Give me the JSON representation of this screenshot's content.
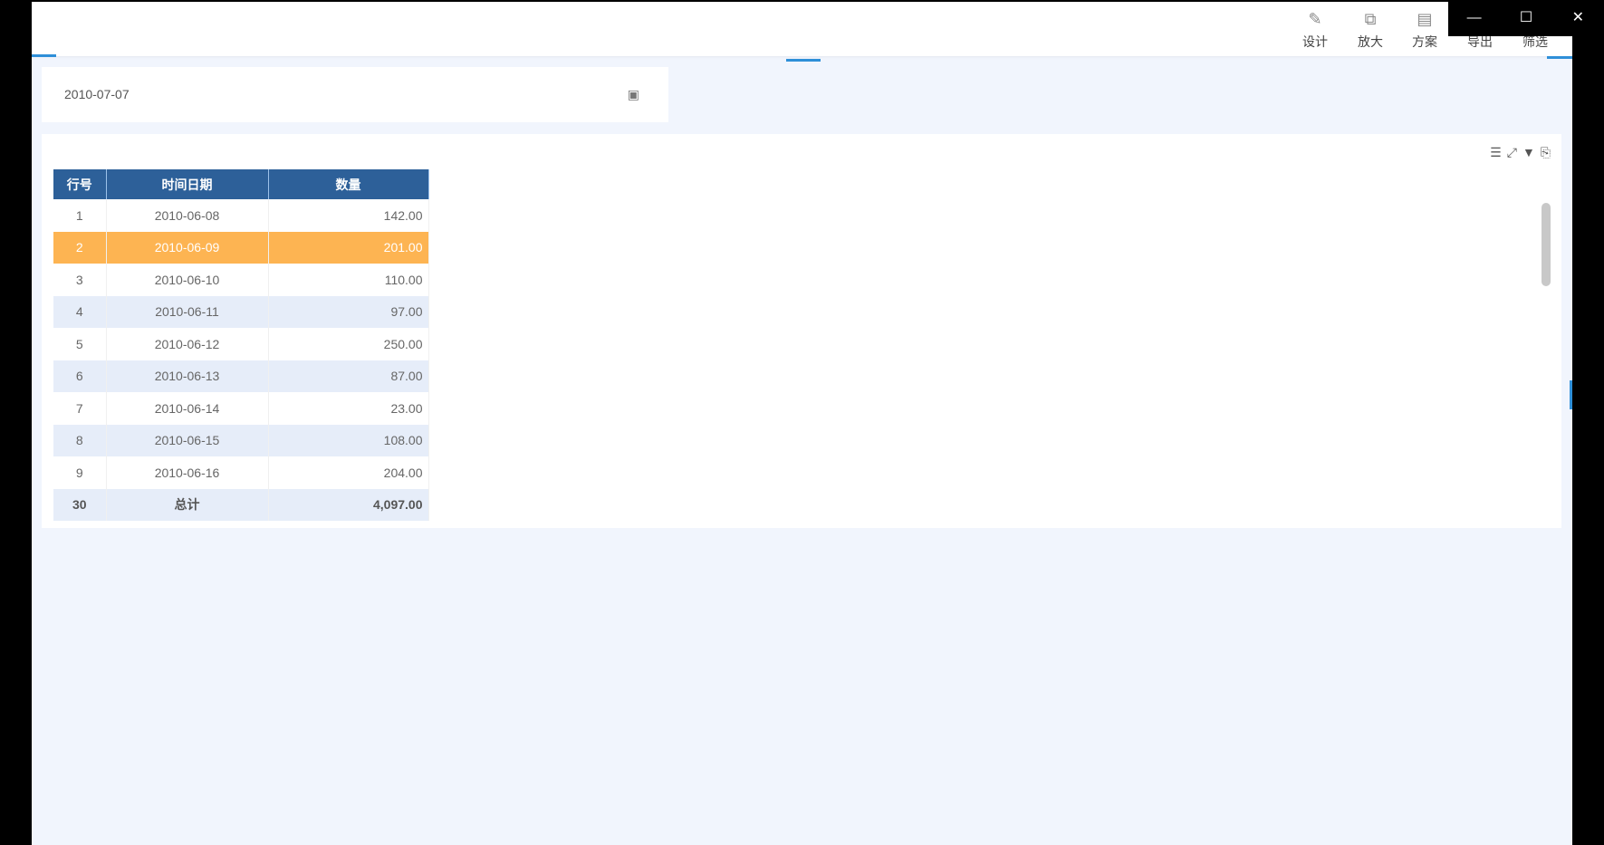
{
  "toolbar": {
    "items": [
      {
        "label": "设计",
        "icon": "pencil-ruler-icon"
      },
      {
        "label": "放大",
        "icon": "zoom-icon"
      },
      {
        "label": "方案",
        "icon": "document-icon"
      },
      {
        "label": "导出",
        "icon": "export-icon"
      },
      {
        "label": "筛选",
        "icon": "filter-icon"
      }
    ]
  },
  "window_controls": {
    "minimize": "—",
    "maximize": "☐",
    "close": "✕"
  },
  "filter": {
    "date_value": "2010-07-07"
  },
  "table": {
    "headers": [
      "行号",
      "时间日期",
      "数量"
    ],
    "rows": [
      [
        "1",
        "2010-06-08",
        "142.00"
      ],
      [
        "2",
        "2010-06-09",
        "201.00"
      ],
      [
        "3",
        "2010-06-10",
        "110.00"
      ],
      [
        "4",
        "2010-06-11",
        "97.00"
      ],
      [
        "5",
        "2010-06-12",
        "250.00"
      ],
      [
        "6",
        "2010-06-13",
        "87.00"
      ],
      [
        "7",
        "2010-06-14",
        "23.00"
      ],
      [
        "8",
        "2010-06-15",
        "108.00"
      ],
      [
        "9",
        "2010-06-16",
        "204.00"
      ]
    ],
    "selected_row": 1,
    "total": [
      "30",
      "总计",
      "4,097.00"
    ]
  },
  "colors": {
    "header": "#2d6099",
    "selected": "#fdb452",
    "accent": "#2e8fd8"
  }
}
